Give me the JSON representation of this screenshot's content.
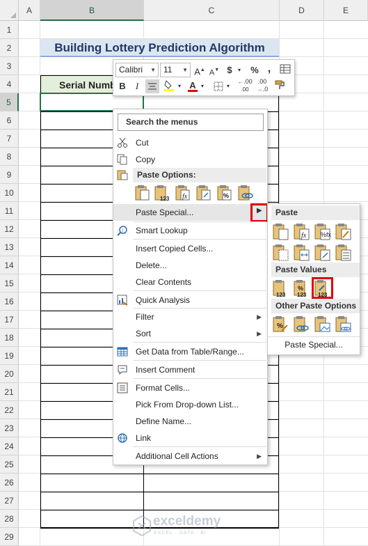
{
  "columns": [
    "A",
    "B",
    "C",
    "D",
    "E"
  ],
  "rows": [
    "1",
    "2",
    "3",
    "4",
    "5",
    "6",
    "7",
    "8",
    "9",
    "10",
    "11",
    "12",
    "13",
    "14",
    "15",
    "16",
    "17",
    "18",
    "19",
    "20",
    "21",
    "22",
    "23",
    "24",
    "25",
    "26",
    "27",
    "28",
    "29"
  ],
  "sheet": {
    "title": "Building Lottery Prediction Algorithm",
    "table_header_b": "Serial Numb"
  },
  "mini_toolbar": {
    "font_name": "Calibri",
    "font_size": "11",
    "grow_font": "A",
    "shrink_font": "A",
    "currency": "$",
    "percent": "%",
    "comma": ",",
    "bold": "B",
    "italic": "I",
    "font_color_letter": "A",
    "dec_increase": ".00",
    "dec_decrease": ".0"
  },
  "context_menu": {
    "search_placeholder": "Search the menus",
    "cut": "Cut",
    "copy": "Copy",
    "paste_options": "Paste Options:",
    "paste_special": "Paste Special...",
    "smart_lookup": "Smart Lookup",
    "insert_copied_cells": "Insert Copied Cells...",
    "delete": "Delete...",
    "clear_contents": "Clear Contents",
    "quick_analysis": "Quick Analysis",
    "filter": "Filter",
    "sort": "Sort",
    "get_data": "Get Data from Table/Range...",
    "insert_comment": "Insert Comment",
    "format_cells": "Format Cells...",
    "pick_dropdown": "Pick From Drop-down List...",
    "define_name": "Define Name...",
    "link": "Link",
    "additional_actions": "Additional Cell Actions",
    "badge_123": "123"
  },
  "submenu": {
    "paste": "Paste",
    "paste_values": "Paste Values",
    "other_paste_options": "Other Paste Options",
    "paste_special": "Paste Special...",
    "badge_123": "123"
  },
  "watermark": {
    "name": "exceldemy",
    "tagline": "EXCEL · DATA · BI"
  },
  "colors": {
    "excel_green": "#217346",
    "highlight_red": "#e00000",
    "title_fill": "#dce6f1",
    "header_fill": "#e2efda"
  }
}
